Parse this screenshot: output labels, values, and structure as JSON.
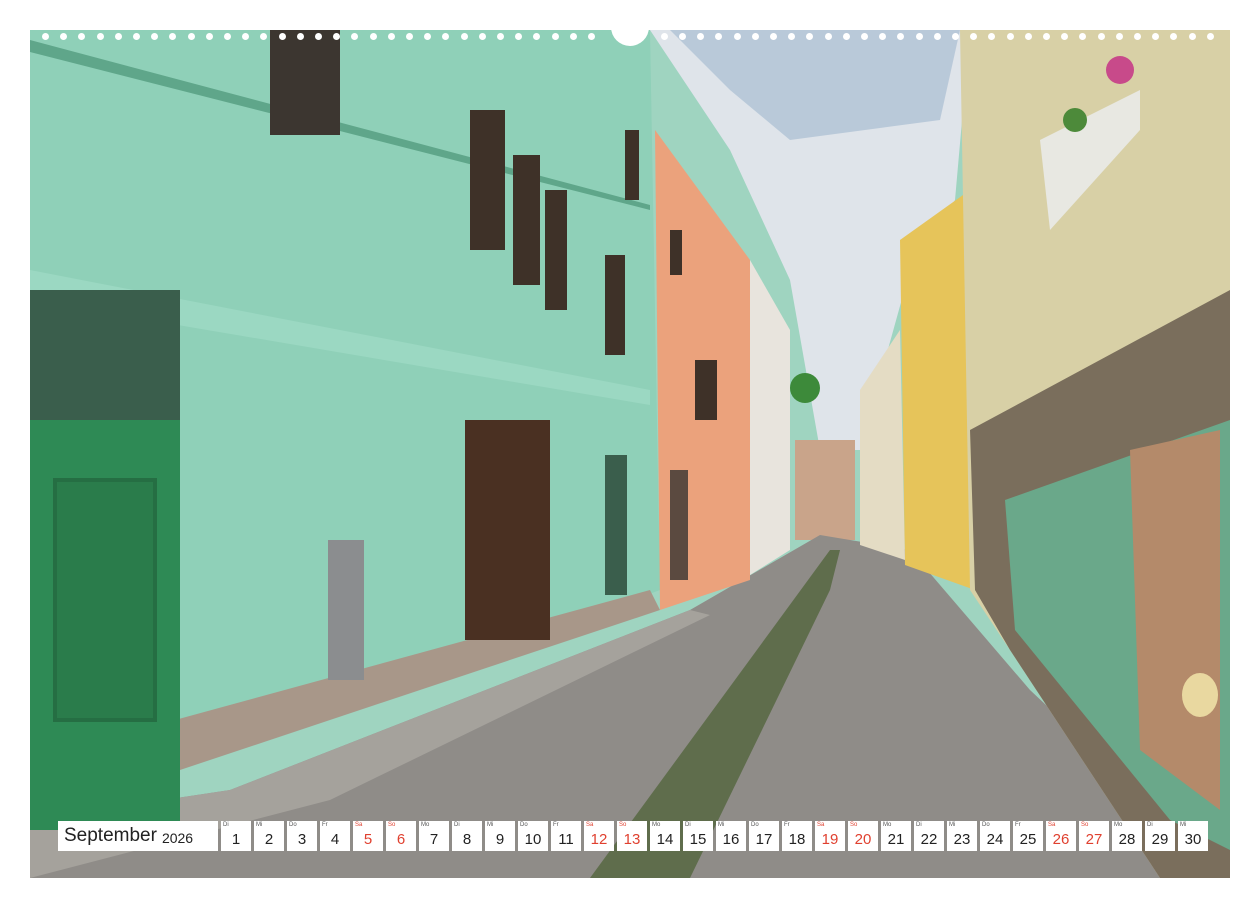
{
  "calendar": {
    "month": "September",
    "year": "2026",
    "days": [
      {
        "wd": "Di",
        "n": "1",
        "weekend": false
      },
      {
        "wd": "Mi",
        "n": "2",
        "weekend": false
      },
      {
        "wd": "Do",
        "n": "3",
        "weekend": false
      },
      {
        "wd": "Fr",
        "n": "4",
        "weekend": false
      },
      {
        "wd": "Sa",
        "n": "5",
        "weekend": true
      },
      {
        "wd": "So",
        "n": "6",
        "weekend": true
      },
      {
        "wd": "Mo",
        "n": "7",
        "weekend": false
      },
      {
        "wd": "Di",
        "n": "8",
        "weekend": false
      },
      {
        "wd": "Mi",
        "n": "9",
        "weekend": false
      },
      {
        "wd": "Do",
        "n": "10",
        "weekend": false
      },
      {
        "wd": "Fr",
        "n": "11",
        "weekend": false
      },
      {
        "wd": "Sa",
        "n": "12",
        "weekend": true
      },
      {
        "wd": "So",
        "n": "13",
        "weekend": true
      },
      {
        "wd": "Mo",
        "n": "14",
        "weekend": false
      },
      {
        "wd": "Di",
        "n": "15",
        "weekend": false
      },
      {
        "wd": "Mi",
        "n": "16",
        "weekend": false
      },
      {
        "wd": "Do",
        "n": "17",
        "weekend": false
      },
      {
        "wd": "Fr",
        "n": "18",
        "weekend": false
      },
      {
        "wd": "Sa",
        "n": "19",
        "weekend": true
      },
      {
        "wd": "So",
        "n": "20",
        "weekend": true
      },
      {
        "wd": "Mo",
        "n": "21",
        "weekend": false
      },
      {
        "wd": "Di",
        "n": "22",
        "weekend": false
      },
      {
        "wd": "Mi",
        "n": "23",
        "weekend": false
      },
      {
        "wd": "Do",
        "n": "24",
        "weekend": false
      },
      {
        "wd": "Fr",
        "n": "25",
        "weekend": false
      },
      {
        "wd": "Sa",
        "n": "26",
        "weekend": true
      },
      {
        "wd": "So",
        "n": "27",
        "weekend": true
      },
      {
        "wd": "Mo",
        "n": "28",
        "weekend": false
      },
      {
        "wd": "Di",
        "n": "29",
        "weekend": false
      },
      {
        "wd": "Mi",
        "n": "30",
        "weekend": false
      }
    ]
  },
  "colors": {
    "weekend": "#e0402f",
    "facade_mint": "#8fd0b8",
    "facade_salmon": "#eba27c",
    "facade_yellow": "#e6c45a",
    "door_green": "#2e8a55"
  }
}
